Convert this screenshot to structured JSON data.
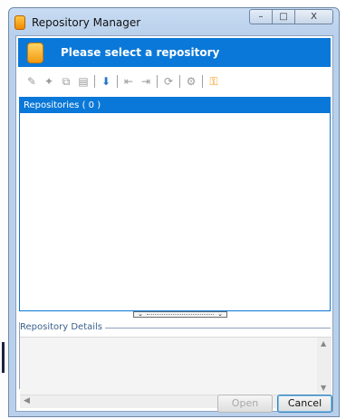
{
  "window": {
    "title": "Repository Manager",
    "caption_buttons": {
      "minimize": "–",
      "maximize": "□",
      "close": "X"
    }
  },
  "header": {
    "title": "Please select a repository"
  },
  "toolbar": {
    "icons": [
      "pencil-icon",
      "new-icon",
      "copy-icon",
      "paste-icon",
      "import-icon",
      "export-in-icon",
      "export-out-icon",
      "refresh-icon",
      "settings-icon",
      "key-icon"
    ]
  },
  "repositories": {
    "header": "Repositories ( 0 )",
    "items": []
  },
  "details": {
    "legend": "Repository Details"
  },
  "buttons": {
    "open": "Open",
    "cancel": "Cancel"
  },
  "colors": {
    "accent": "#0a78d8",
    "title_bar": "#b9d0ec",
    "db_icon": "#f5a623"
  }
}
